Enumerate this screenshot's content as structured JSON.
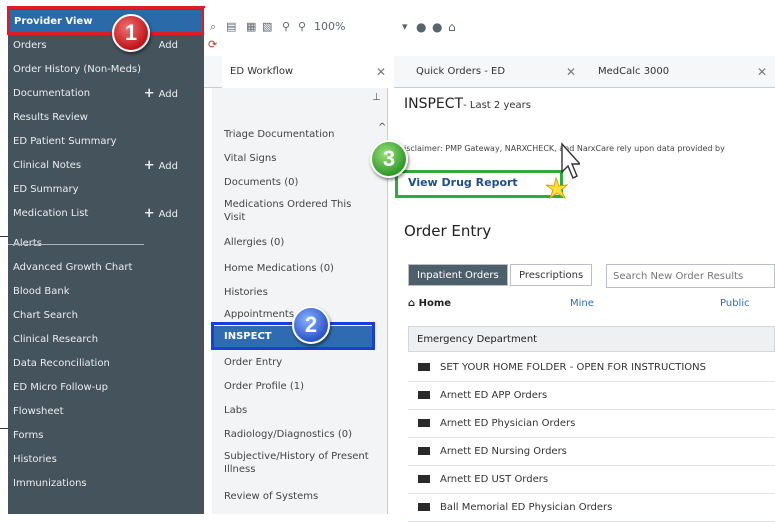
{
  "sidebar": {
    "active": "Provider View",
    "items": [
      {
        "label": "Orders",
        "add": "Add"
      },
      {
        "label": "Order History (Non-Meds)",
        "add": ""
      },
      {
        "label": "Documentation",
        "add": "Add"
      },
      {
        "label": "Results Review",
        "add": ""
      },
      {
        "label": "ED Patient Summary",
        "add": ""
      },
      {
        "label": "Clinical Notes",
        "add": "Add"
      },
      {
        "label": "ED Summary",
        "add": ""
      },
      {
        "label": "Medication List",
        "add": "Add"
      },
      {
        "label": "Alerts",
        "add": ""
      },
      {
        "label": "Advanced Growth Chart",
        "add": ""
      },
      {
        "label": "Blood Bank",
        "add": ""
      },
      {
        "label": "Chart Search",
        "add": ""
      },
      {
        "label": "Clinical Research",
        "add": ""
      },
      {
        "label": "Data Reconciliation",
        "add": ""
      },
      {
        "label": "ED Micro Follow-up",
        "add": ""
      },
      {
        "label": "Flowsheet",
        "add": ""
      },
      {
        "label": "Forms",
        "add": ""
      },
      {
        "label": "Histories",
        "add": ""
      },
      {
        "label": "Immunizations",
        "add": ""
      }
    ]
  },
  "toolbar": {
    "zoom": "100%"
  },
  "tabs": [
    {
      "label": "ED Workflow"
    },
    {
      "label": "Quick Orders - ED"
    },
    {
      "label": "MedCalc 3000"
    }
  ],
  "workflow": {
    "items": [
      "Triage Documentation",
      "Vital Signs",
      "Documents (0)",
      "Medications Ordered This Visit",
      "Allergies (0)",
      "Home Medications (0)",
      "Histories",
      "Appointments",
      "INSPECT",
      "Order Entry",
      "Order Profile (1)",
      "Labs",
      "Radiology/Diagnostics (0)",
      "Subjective/History of Present Illness",
      "Review of Systems"
    ],
    "active": "INSPECT"
  },
  "inspect": {
    "title": "INSPECT",
    "subtitle": "- Last 2 years",
    "disclaimer": "isclaimer: PMP Gateway, NARXCHECK, and NarxCare rely upon data provided by",
    "link": "View Drug Report"
  },
  "order_entry": {
    "title": "Order Entry",
    "btn_inpatient": "Inpatient Orders",
    "btn_prescriptions": "Prescriptions",
    "search_placeholder": "Search New Order Results",
    "nav_home": "Home",
    "nav_mine": "Mine",
    "nav_public": "Public",
    "list_header": "Emergency Department",
    "folders": [
      "SET YOUR HOME FOLDER - OPEN FOR INSTRUCTIONS",
      "Arnett ED APP Orders",
      "Arnett ED Physician Orders",
      "Arnett ED Nursing Orders",
      "Arnett ED UST Orders",
      "Ball Memorial ED Physician Orders"
    ]
  },
  "callouts": {
    "one": "1",
    "two": "2",
    "three": "3"
  }
}
